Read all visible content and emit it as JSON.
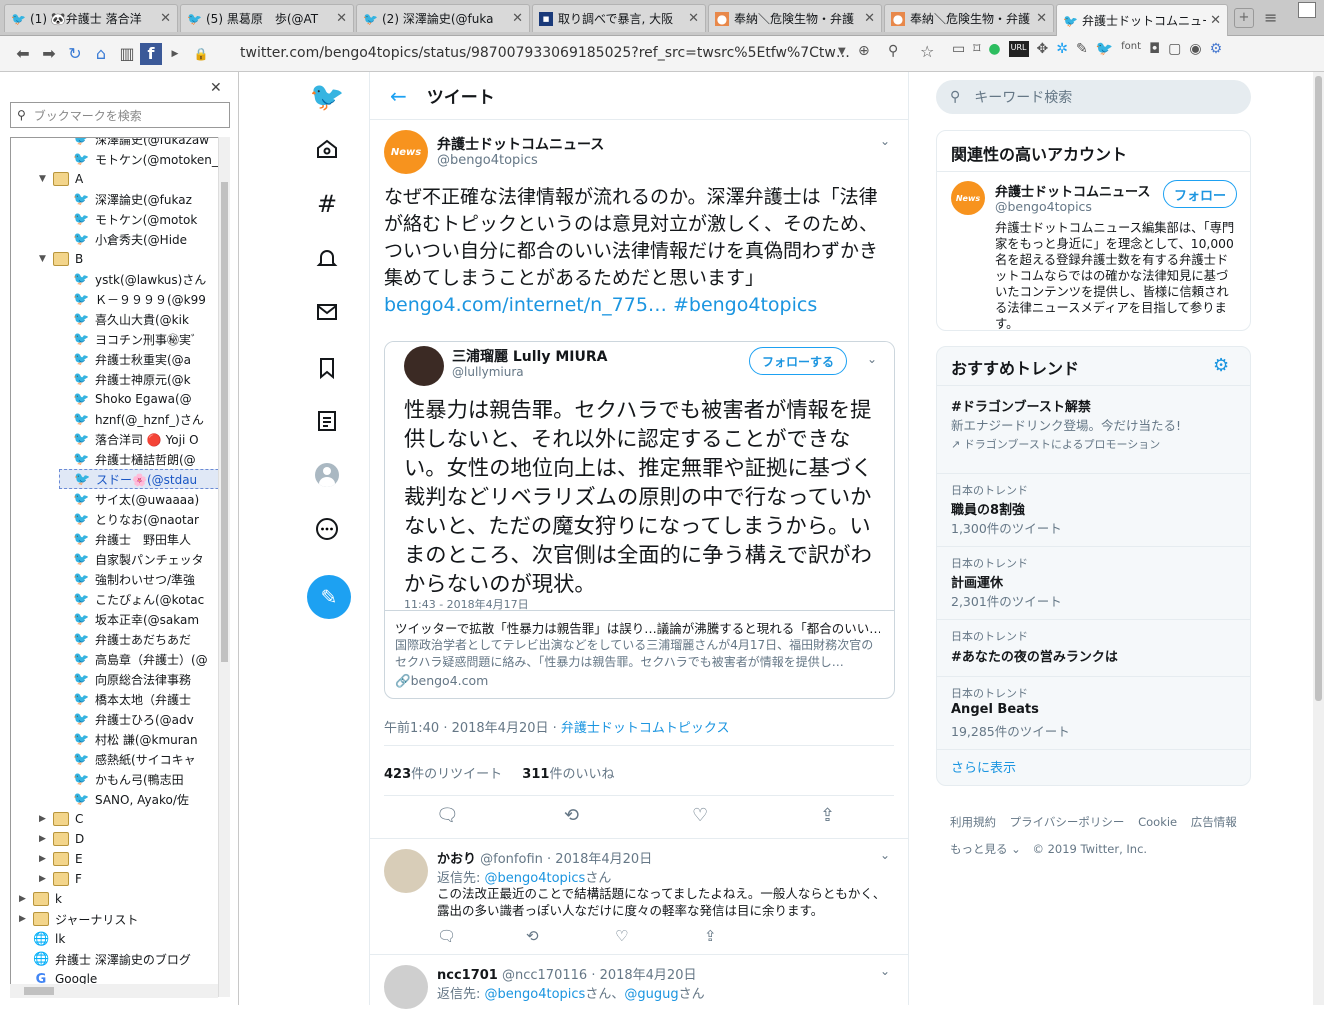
{
  "browser": {
    "tabs": [
      {
        "icon": "twitter-icon",
        "title": "(1) 🐼弁護士 落合洋"
      },
      {
        "icon": "twitter-icon",
        "title": "(5) 黒葛原　歩(@AT"
      },
      {
        "icon": "twitter-icon",
        "title": "(2) 深澤論史(@fuka"
      },
      {
        "icon": "news-icon",
        "title": "取り調べで暴言, 大阪"
      },
      {
        "icon": "news-icon",
        "title": "奉納＼危険生物・弁護"
      },
      {
        "icon": "news-icon",
        "title": "奉納＼危険生物・弁護"
      },
      {
        "icon": "twitter-icon",
        "title": "弁護士ドットコムニュー"
      }
    ],
    "url": "twitter.com/bengo4topics/status/987007933069185025?ref_src=twsrc%5Etfw%7Ctw…"
  },
  "bookmarks": {
    "search_placeholder": "ブックマークを検索",
    "items": [
      {
        "type": "tw",
        "label": "深澤論史(@fukazaw",
        "indent": 3
      },
      {
        "type": "tw",
        "label": "モトケン(@motoken_",
        "indent": 3
      },
      {
        "type": "folder",
        "label": "A",
        "indent": 2,
        "open": true
      },
      {
        "type": "tw",
        "label": "深澤論史(@fukaz",
        "indent": 3
      },
      {
        "type": "tw",
        "label": "モトケン(@motok",
        "indent": 3
      },
      {
        "type": "tw",
        "label": "小倉秀夫(@Hide",
        "indent": 3
      },
      {
        "type": "folder",
        "label": "B",
        "indent": 2,
        "open": true
      },
      {
        "type": "tw",
        "label": "ystk(@lawkus)さん",
        "indent": 3
      },
      {
        "type": "tw",
        "label": "Ｋ－９９９９(@k99",
        "indent": 3
      },
      {
        "type": "tw",
        "label": "喜久山大貴(@kik",
        "indent": 3
      },
      {
        "type": "tw",
        "label": "ヨコチン刑事㊙実ﾞ",
        "indent": 3
      },
      {
        "type": "tw",
        "label": "弁護士秋重実(@a",
        "indent": 3
      },
      {
        "type": "tw",
        "label": "弁護士神原元(@k",
        "indent": 3
      },
      {
        "type": "tw",
        "label": "Shoko Egawa(@",
        "indent": 3
      },
      {
        "type": "tw",
        "label": "hznf(@_hznf_)さん",
        "indent": 3
      },
      {
        "type": "tw",
        "label": "落合洋司 🔴 Yoji O",
        "indent": 3
      },
      {
        "type": "tw",
        "label": "弁護士樋詰哲朗(@",
        "indent": 3
      },
      {
        "type": "tw",
        "label": "スドー🌸(@stdau",
        "indent": 3,
        "selected": true
      },
      {
        "type": "tw",
        "label": "サイ太(@uwaaaa)",
        "indent": 3
      },
      {
        "type": "tw",
        "label": "とりなお(@naotar",
        "indent": 3
      },
      {
        "type": "tw",
        "label": "弁護士　野田隼人",
        "indent": 3
      },
      {
        "type": "tw",
        "label": "自家製パンチェッタ",
        "indent": 3
      },
      {
        "type": "tw",
        "label": "強制わいせつ/準強",
        "indent": 3
      },
      {
        "type": "tw",
        "label": "こたぴょん(@kotac",
        "indent": 3
      },
      {
        "type": "tw",
        "label": "坂本正幸(@sakam",
        "indent": 3
      },
      {
        "type": "tw",
        "label": "弁護士あだちあだ",
        "indent": 3
      },
      {
        "type": "tw",
        "label": "高島章（弁護士）(@",
        "indent": 3
      },
      {
        "type": "tw",
        "label": "向原総合法律事務",
        "indent": 3
      },
      {
        "type": "tw",
        "label": "橋本太地（弁護士",
        "indent": 3
      },
      {
        "type": "tw",
        "label": "弁護士ひろ(@adv",
        "indent": 3
      },
      {
        "type": "tw",
        "label": "村松 謙(@kmuran",
        "indent": 3
      },
      {
        "type": "tw",
        "label": "感熱紙(サイコキャ",
        "indent": 3
      },
      {
        "type": "tw",
        "label": "かもん弓(鴨志田",
        "indent": 3
      },
      {
        "type": "tw",
        "label": "SANO, Ayako/佐",
        "indent": 3
      },
      {
        "type": "folder",
        "label": "C",
        "indent": 2,
        "open": false
      },
      {
        "type": "folder",
        "label": "D",
        "indent": 2,
        "open": false
      },
      {
        "type": "folder",
        "label": "E",
        "indent": 2,
        "open": false
      },
      {
        "type": "folder",
        "label": "F",
        "indent": 2,
        "open": false
      },
      {
        "type": "folder",
        "label": "k",
        "indent": 1,
        "open": false
      },
      {
        "type": "folder",
        "label": "ジャーナリスト",
        "indent": 1,
        "open": false
      },
      {
        "type": "globe",
        "label": "lk",
        "indent": 1
      },
      {
        "type": "globe",
        "label": "弁護士 深澤諭史のブログ",
        "indent": 1
      },
      {
        "type": "google",
        "label": "Google",
        "indent": 1
      }
    ]
  },
  "header": {
    "title": "ツイート"
  },
  "tweet": {
    "name": "弁護士ドットコムニュース",
    "handle": "@bengo4topics",
    "text": "なぜ不正確な法律情報が流れるのか。深澤弁護士は「法律が絡むトピックというのは意見対立が激しく、そのため、ついつい自分に都合のいい法律情報だけを真偽問わずかき集めてしまうことがあるためだと思います」",
    "link1": "bengo4.com/internet/n_775…",
    "hashtag": "#bengo4topics",
    "card": {
      "embed_name": "三浦瑠麗 Lully MIURA",
      "embed_handle": "@lullymiura",
      "embed_follow": "フォローする",
      "embed_text": "性暴力は親告罪。セクハラでも被害者が情報を提供しないと、それ以外に認定することができない。女性の地位向上は、推定無罪や証拠に基づく裁判などリベラリズムの原則の中で行なっていかないと、ただの魔女狩りになってしまうから。いまのところ、次官側は全面的に争う構えで訳がわからないのが現状。",
      "embed_time": "11:43 - 2018年4月17日",
      "title": "ツイッターで拡散「性暴力は親告罪」は誤り…議論が沸騰すると現れる「都合のいい…",
      "desc": "国際政治学者としてテレビ出演などをしている三浦瑠麗さんが4月17日、福田財務次官のセクハラ疑惑問題に絡み、「性暴力は親告罪。セクハラでも被害者が情報を提供し…",
      "domain": "bengo4.com"
    },
    "time": "午前1:40 · 2018年4月20日",
    "source": "弁護士ドットコムトピックス",
    "retweets": "423",
    "retweets_label": "件のリツイート",
    "likes": "311",
    "likes_label": "件のいいね"
  },
  "replies": [
    {
      "name": "かおり",
      "handle": "@fonfofin",
      "date": "2018年4月20日",
      "reply_to_label": "返信先:",
      "reply_to": "@bengo4topics",
      "reply_suffix": "さん",
      "text": "この法改正最近のことで結構話題になってましたよねえ。一般人ならともかく、露出の多い識者っぽい人なだけに度々の軽率な発信は目に余ります。"
    },
    {
      "name": "ncc1701",
      "handle": "@ncc170116",
      "date": "2018年4月20日",
      "reply_to_label": "返信先:",
      "reply_to": "@bengo4topics",
      "reply_suffix": "さん、",
      "reply_to2": "@gugug",
      "reply_suffix2": "さん"
    }
  ],
  "search": {
    "placeholder": "キーワード検索"
  },
  "related": {
    "title": "関連性の高いアカウント",
    "name": "弁護士ドットコムニュース",
    "handle": "@bengo4topics",
    "follow": "フォロー",
    "bio": "弁護士ドットコムニュース編集部は、「専門家をもっと身近に」を理念として、10,000名を超える登録弁護士数を有する弁護士ドットコムならではの確かな法律知見に基づいたコンテンツを提供し、皆様に信頼される法律ニュースメディアを目指して参ります。"
  },
  "trends": {
    "title": "おすすめトレンド",
    "items": [
      {
        "meta": "",
        "name": "#ドラゴンブースト解禁",
        "sub": "新エナジードリンク登場。今だけ当たる!",
        "promo": "ドラゴンブーストによるプロモーション"
      },
      {
        "meta": "日本のトレンド",
        "name": "職員の8割強",
        "sub": "1,300件のツイート"
      },
      {
        "meta": "日本のトレンド",
        "name": "計画運休",
        "sub": "2,301件のツイート"
      },
      {
        "meta": "日本のトレンド",
        "name": "#あなたの夜の営みランクは",
        "sub": ""
      },
      {
        "meta": "日本のトレンド",
        "name": "Angel Beats",
        "sub": "19,285件のツイート"
      }
    ],
    "more": "さらに表示"
  },
  "footer": {
    "links": [
      "利用規約",
      "プライバシーポリシー",
      "Cookie",
      "広告情報"
    ],
    "more": "もっと見る",
    "copyright": "© 2019 Twitter, Inc."
  }
}
